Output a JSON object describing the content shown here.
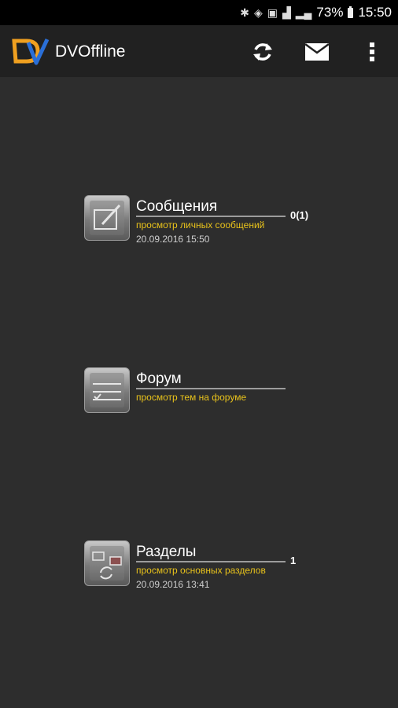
{
  "status_bar": {
    "battery": "73%",
    "time": "15:50"
  },
  "app_bar": {
    "title": "DVOffline",
    "actions": [
      "refresh-icon",
      "mail-icon",
      "more-vert-icon"
    ]
  },
  "items": [
    {
      "title": "Сообщения",
      "subtitle": "просмотр личных сообщений",
      "date": "20.09.2016 15:50",
      "count": "0(1)"
    },
    {
      "title": "Форум",
      "subtitle": "просмотр тем на форуме",
      "date": "",
      "count": ""
    },
    {
      "title": "Разделы",
      "subtitle": "просмотр основных разделов",
      "date": "20.09.2016 13:41",
      "count": "1"
    }
  ],
  "colors": {
    "background": "#2d2d2d",
    "app_bar": "#212121",
    "subtitle": "#e8c21b"
  }
}
